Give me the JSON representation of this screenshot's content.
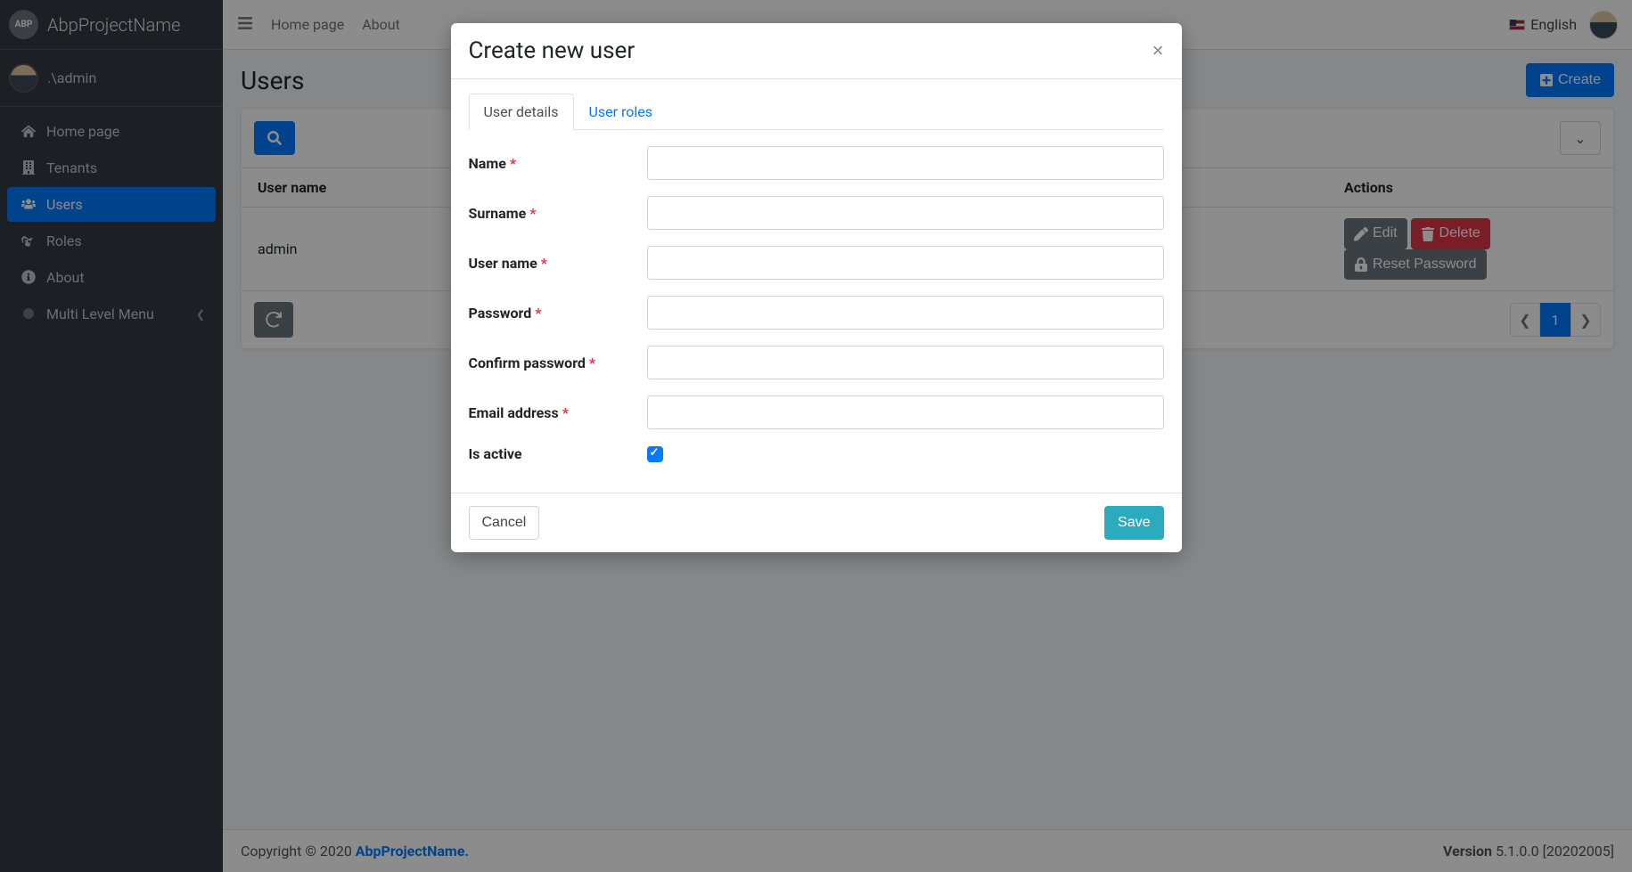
{
  "brand": {
    "name": "AbpProjectName",
    "logo_text": "ABP"
  },
  "user_panel": {
    "name": ".\\admin"
  },
  "sidebar_items": [
    {
      "key": "home",
      "label": "Home page",
      "icon": "home"
    },
    {
      "key": "tenants",
      "label": "Tenants",
      "icon": "building"
    },
    {
      "key": "users",
      "label": "Users",
      "icon": "users",
      "active": true
    },
    {
      "key": "roles",
      "label": "Roles",
      "icon": "masks"
    },
    {
      "key": "about",
      "label": "About",
      "icon": "info"
    },
    {
      "key": "multilevel",
      "label": "Multi Level Menu",
      "icon": "dot",
      "has_children": true
    }
  ],
  "topnav": {
    "links": [
      "Home page",
      "About"
    ],
    "language": "English"
  },
  "page": {
    "title": "Users",
    "create_label": "Create"
  },
  "table": {
    "headers": {
      "username": "User name",
      "actions": "Actions"
    },
    "rows": [
      {
        "username": "admin"
      }
    ],
    "row_buttons": {
      "edit": "Edit",
      "delete": "Delete",
      "reset": "Reset Password"
    },
    "current_page": "1"
  },
  "footer": {
    "copyright_prefix": "Copyright © 2020 ",
    "project_link": "AbpProjectName",
    "version_label": "Version",
    "version_value": "5.1.0.0 [20202005]"
  },
  "modal": {
    "title": "Create new user",
    "tabs": {
      "details": "User details",
      "roles": "User roles"
    },
    "fields": {
      "name": "Name",
      "surname": "Surname",
      "username": "User name",
      "password": "Password",
      "confirm_password": "Confirm password",
      "email": "Email address",
      "is_active": "Is active"
    },
    "buttons": {
      "cancel": "Cancel",
      "save": "Save"
    },
    "is_active_checked": true
  }
}
